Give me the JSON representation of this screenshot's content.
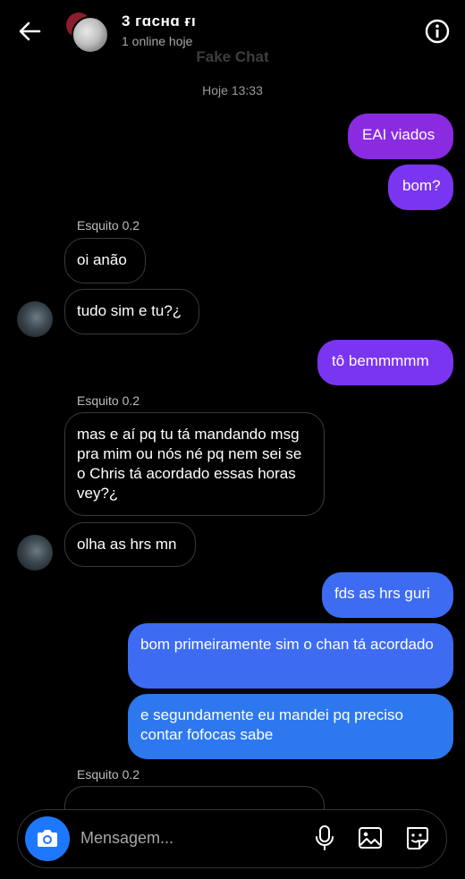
{
  "header": {
    "title": "3 ᴦɑᴄʜɑ ғı",
    "subtitle": "1 online hoje"
  },
  "watermark": "Fake Chat",
  "timestamp": "Hoje 13:33",
  "sender_name": "Esquito 0.2",
  "messages": {
    "m1": "EAI viados",
    "m2": "bom?",
    "m3": "oi anão",
    "m4": "tudo sim e tu?¿",
    "m5": "tô bemmmmm",
    "m6": "mas e aí pq tu tá mandando msg pra mim ou nós né pq nem sei se o Chris tá acordado essas horas vey?¿",
    "m7": "olha as hrs mn",
    "m8": "fds as hrs guri",
    "m9": "bom primeiramente sim o chan tá acordado",
    "m10": "e segundamente eu mandei pq preciso contar fofocas sabe"
  },
  "composer": {
    "placeholder": "Mensagem..."
  },
  "icons": {
    "back": "arrow-left-icon",
    "info": "info-icon",
    "camera": "camera-icon",
    "mic": "microphone-icon",
    "gallery": "image-icon",
    "sticker": "sticker-icon"
  },
  "colors": {
    "background": "#000000",
    "outgoing_purple": "#8a2be2",
    "outgoing_blue": "#3d6cf2",
    "camera_button": "#1e78ff"
  }
}
